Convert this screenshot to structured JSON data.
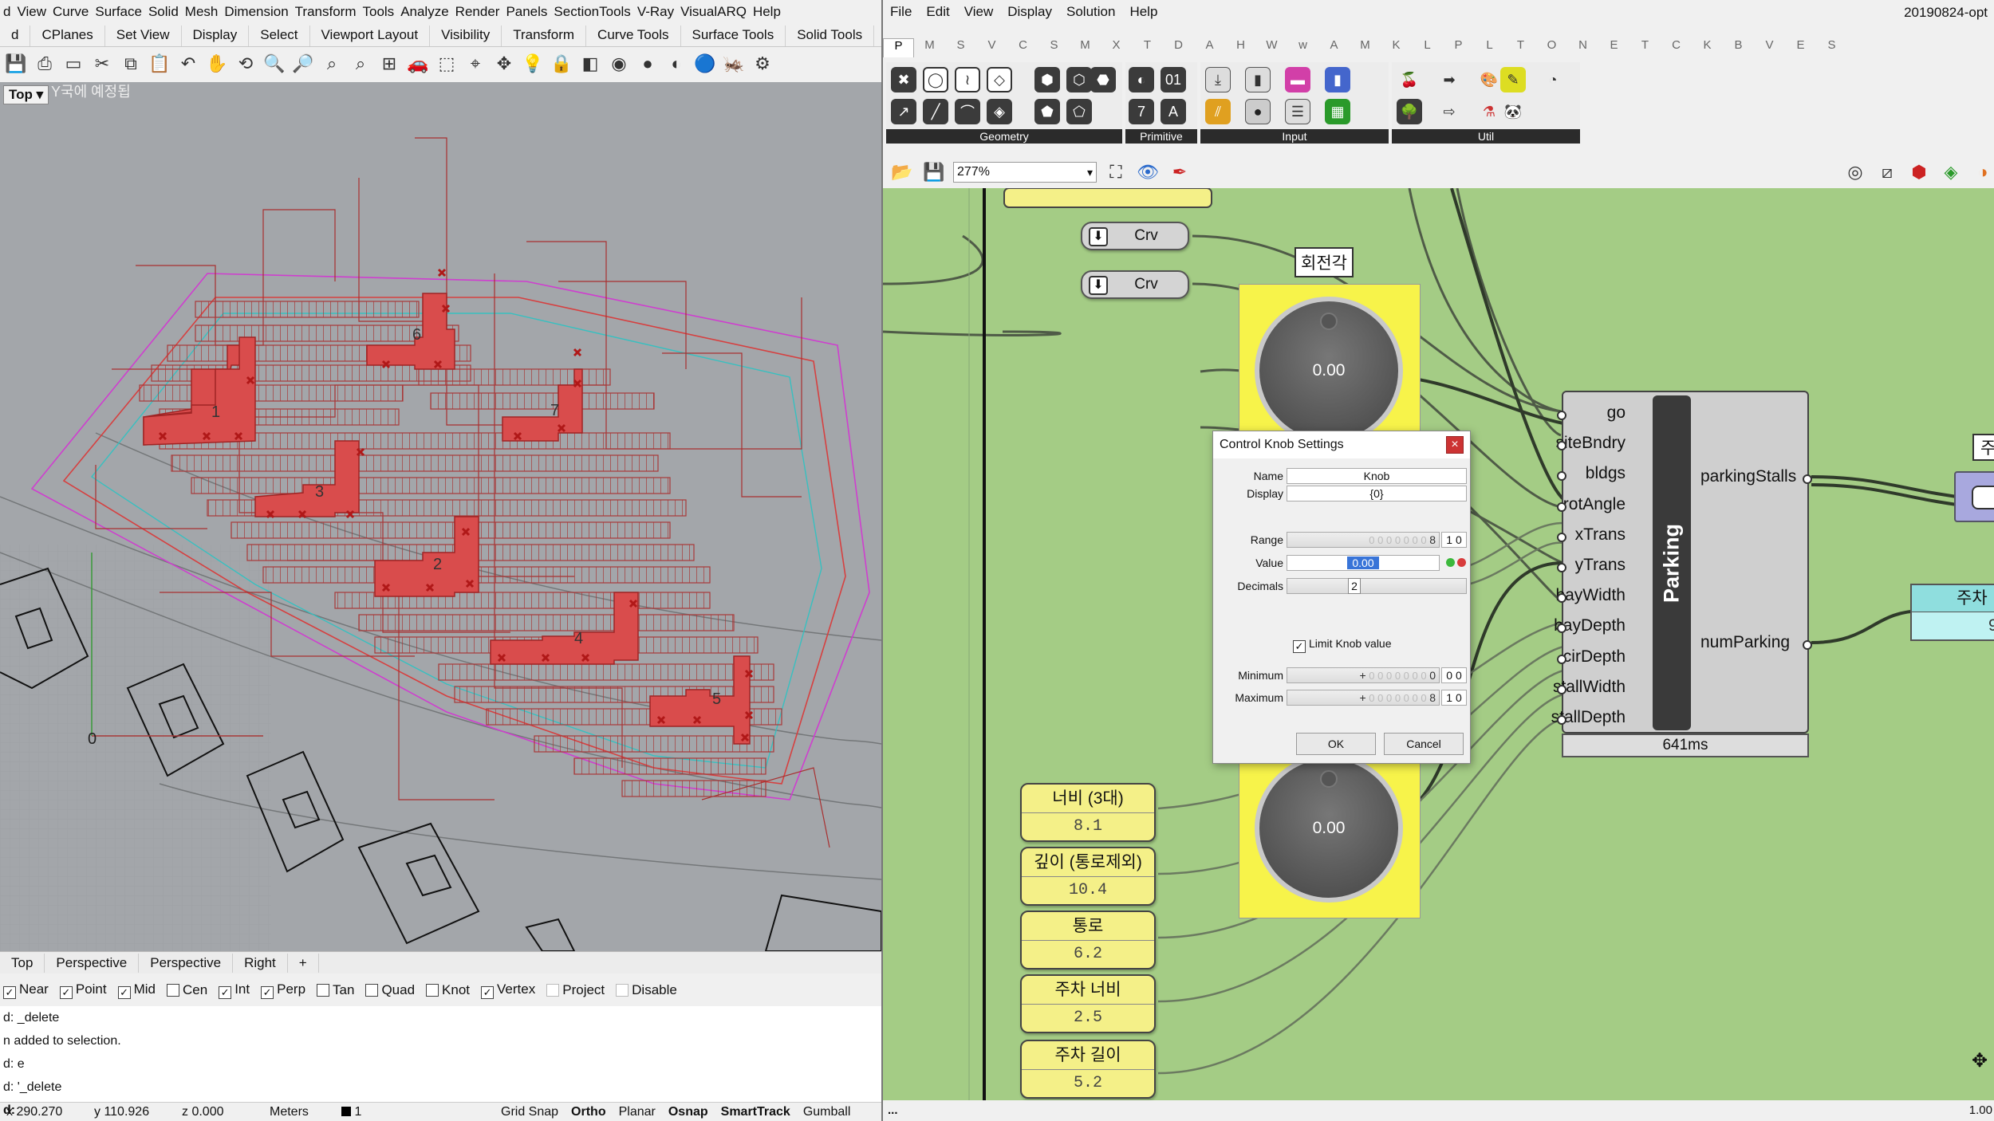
{
  "rhino": {
    "menu": [
      "View",
      "Curve",
      "Surface",
      "Solid",
      "Mesh",
      "Dimension",
      "Transform",
      "Tools",
      "Analyze",
      "Render",
      "Panels",
      "SectionTools",
      "V-Ray",
      "VisualARQ",
      "Help"
    ],
    "menu_first": "d",
    "tabs": [
      "d",
      "CPlanes",
      "Set View",
      "Display",
      "Select",
      "Viewport Layout",
      "Visibility",
      "Transform",
      "Curve Tools",
      "Surface Tools",
      "Solid Tools"
    ],
    "viewport_label": "Top",
    "viewport_overlay_text": "Υ국에 예정됩",
    "viewport_tabs": [
      "Top",
      "Perspective",
      "Perspective",
      "Right"
    ],
    "origin_label": "0",
    "group_numbers": [
      "1",
      "6",
      "7",
      "3",
      "2",
      "4",
      "5"
    ],
    "osnaps": [
      {
        "label": "Near",
        "checked": true
      },
      {
        "label": "Point",
        "checked": true
      },
      {
        "label": "Mid",
        "checked": true
      },
      {
        "label": "Cen",
        "checked": false
      },
      {
        "label": "Int",
        "checked": true
      },
      {
        "label": "Perp",
        "checked": true
      },
      {
        "label": "Tan",
        "checked": false
      },
      {
        "label": "Quad",
        "checked": false
      },
      {
        "label": "Knot",
        "checked": false
      },
      {
        "label": "Vertex",
        "checked": true
      },
      {
        "label": "Project",
        "checked": false
      },
      {
        "label": "Disable",
        "checked": false
      }
    ],
    "command_history": [
      "d: _delete",
      "n added to selection.",
      "d: e",
      "d: '_delete",
      "d:"
    ],
    "status": {
      "x": "x 290.270",
      "y": "y 110.926",
      "z": "z 0.000",
      "units": "Meters",
      "layer": "1",
      "toggles": [
        "Grid Snap",
        "Ortho",
        "Planar",
        "Osnap",
        "SmartTrack",
        "Gumball"
      ]
    }
  },
  "gh": {
    "menu": [
      "File",
      "Edit",
      "View",
      "Display",
      "Solution",
      "Help"
    ],
    "title": "20190824-opt",
    "tabs": [
      "P",
      "M",
      "S",
      "V",
      "C",
      "S",
      "M",
      "X",
      "T",
      "D",
      "A",
      "H",
      "W",
      "w",
      "A",
      "M",
      "K",
      "L",
      "P",
      "L",
      "T",
      "O",
      "N",
      "E",
      "T",
      "C",
      "K",
      "B",
      "V",
      "E",
      "S"
    ],
    "ribbon_groups": [
      "Geometry",
      "Primitive",
      "Input",
      "Util"
    ],
    "zoom": "277%",
    "crv_label": "Crv",
    "rotation_label": "회전각",
    "knob_value_top": "0.00",
    "knob_value_bottom": "0.00",
    "parking": {
      "title": "Parking",
      "inputs": [
        "go",
        "siteBndry",
        "bldgs",
        "rotAngle",
        "xTrans",
        "yTrans",
        "bayWidth",
        "bayDepth",
        "cirDepth",
        "stallWidth",
        "stallDepth"
      ],
      "outputs": [
        "parkingStalls",
        "numParking"
      ],
      "time": "641ms"
    },
    "sliders": [
      {
        "name": "너비 (3대)",
        "value": "8.1"
      },
      {
        "name": "깊이 (통로제외)",
        "value": "10.4"
      },
      {
        "name": "통로",
        "value": "6.2"
      },
      {
        "name": "주차 너비",
        "value": "2.5"
      },
      {
        "name": "주차 길이",
        "value": "5.2"
      }
    ],
    "right_panel_label": "주차",
    "right_panel_value": "9",
    "right_top_label": "주",
    "status_right": "1.00",
    "status_left": "..."
  },
  "dialog": {
    "title": "Control Knob Settings",
    "close": "×",
    "name_label": "Name",
    "name_value": "Knob",
    "display_label": "Display",
    "display_value": "{0}",
    "range_label": "Range",
    "range_value": "8",
    "range_digits": "1 0",
    "value_label": "Value",
    "value_value": "0.00",
    "decimals_label": "Decimals",
    "decimals_value": "2",
    "limit_label": "Limit Knob value",
    "limit_checked": true,
    "minimum_label": "Minimum",
    "minimum_value": "0",
    "minimum_digits": "0 0",
    "minimum_sign": "+",
    "maximum_label": "Maximum",
    "maximum_value": "8",
    "maximum_digits": "1 0",
    "maximum_sign": "+",
    "ok": "OK",
    "cancel": "Cancel"
  },
  "colors": {
    "rhino_viewport": "#a3a6aa",
    "gh_canvas": "#a4cc85",
    "building": "#d94c4c",
    "slider": "#f4f088",
    "knob_bg": "#f7f34a",
    "accent_blue": "#3874d8"
  }
}
